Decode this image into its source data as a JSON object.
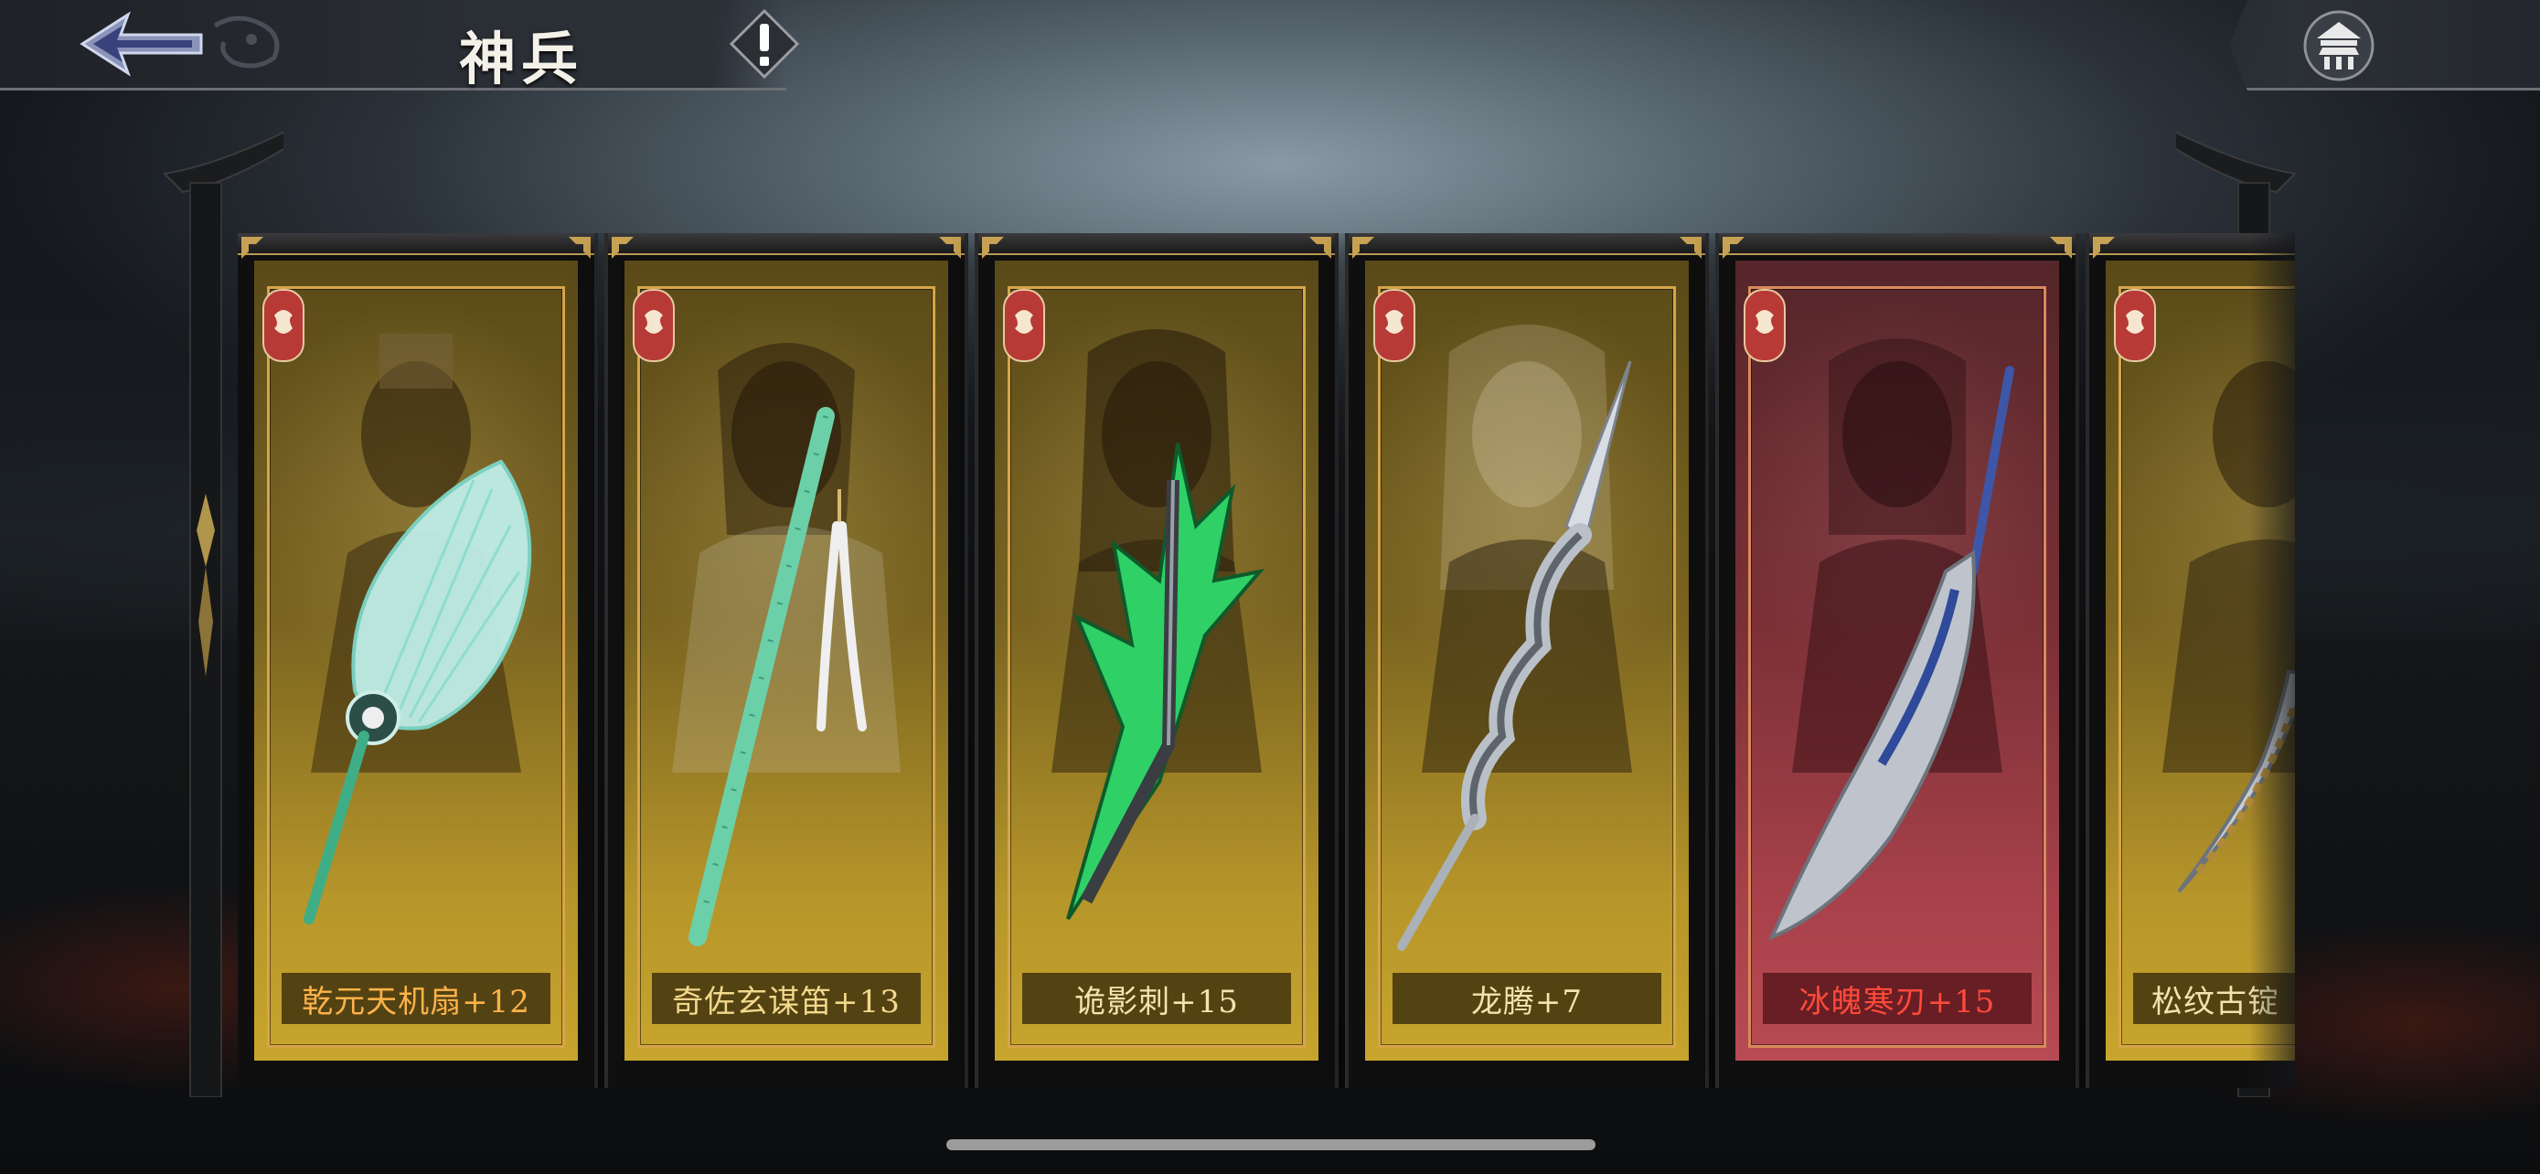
{
  "header": {
    "title": "神兵",
    "back_icon": "back-arrow-icon",
    "info_icon": "exclamation-icon",
    "home_icon": "palace-icon"
  },
  "cards": [
    {
      "label": "乾元天机扇+12",
      "weapon": "fan",
      "theme": "gold",
      "label_color": "#ffb24a"
    },
    {
      "label": "奇佐玄谋笛+13",
      "weapon": "flute",
      "theme": "gold",
      "label_color": "#f2d88c"
    },
    {
      "label": "诡影刺+15",
      "weapon": "green-trident",
      "theme": "gold",
      "label_color": "#f3e3b0"
    },
    {
      "label": "龙腾+7",
      "weapon": "silver-spear",
      "theme": "gold",
      "label_color": "#f3e3b0"
    },
    {
      "label": "冰魄寒刃+15",
      "weapon": "glaive",
      "theme": "red",
      "label_color": "#ff4a3a"
    },
    {
      "label": "松纹古锭",
      "weapon": "sword",
      "theme": "gold",
      "label_color": "#f3e3b0"
    }
  ],
  "colors": {
    "frame_gold": "#d7a548",
    "panel_gold": "#b7962a",
    "panel_red": "#a8414a"
  }
}
